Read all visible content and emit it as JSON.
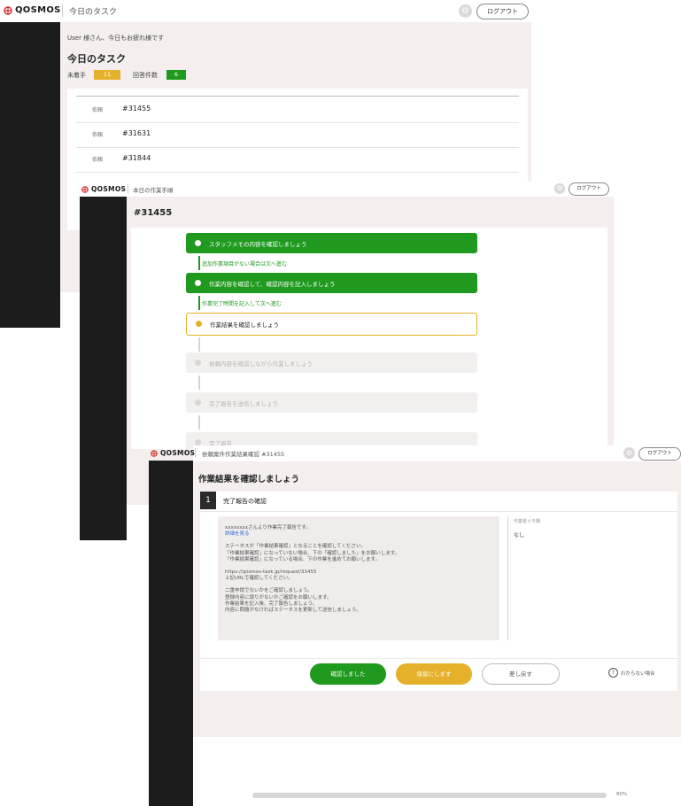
{
  "brand": {
    "logo": "QOSMOS"
  },
  "common": {
    "logout_label": "ログアウト",
    "gear_glyph": "⚙"
  },
  "window1": {
    "header_title": "今日のタスク",
    "greeting": "User 様さん、今日もお疲れ様です",
    "page_title": "今日のタスク",
    "stat_labels": [
      "未着手",
      "回答件数"
    ],
    "stat_values": [
      "11",
      "6"
    ],
    "rows": [
      {
        "label": "依頼",
        "value": "#31455"
      },
      {
        "label": "依頼",
        "value": "#31631"
      },
      {
        "label": "依頼",
        "value": "#31844"
      }
    ]
  },
  "window2": {
    "header_title": "本日の作業手順",
    "page_title": "#31455",
    "steps": [
      {
        "label": "スタッフメモの内容を確認しましょう",
        "state": "done"
      },
      {
        "label": "作業内容を確認して、確認内容を記入しましょう",
        "state": "done"
      },
      {
        "label": "作業結果を確認しましょう",
        "state": "current"
      },
      {
        "label": "依頼内容を確認しながら作業しましょう",
        "state": "todo"
      },
      {
        "label": "完了報告を送信しましょう",
        "state": "todo"
      },
      {
        "label": "完了報告",
        "state": "todo"
      }
    ],
    "notes": [
      "追加作業項目がない場合は次へ進む",
      "作業完了時間を記入して次へ進む"
    ]
  },
  "window3": {
    "header_title": "依頼案件作業結果確認 #31455",
    "page_title": "作業結果を確認しましょう",
    "section_number": "1",
    "section_title": "完了報告の確認",
    "message_lines": [
      "xxxxxxxxさんより作業完了報告です。",
      "詳細を見る",
      "",
      "ステータスが「作業結果確認」となることを確認してください。",
      "「作業結果確認」になっていない場合、下の「確認しました」をお願いします。",
      "「作業結果確認」になっている場合、下の作業を進めてお願いします。",
      "",
      "https://qosmos-task.jp/request/31455",
      "上記URLで確認してください。",
      "",
      "二重申請でないかをご確認しましょう。",
      "登録内容に誤りがないかご確認をお願いします。",
      "作業結果を記入後、完了報告しましょう。",
      "内容に問題がなければステータスを更新して送信しましょう。"
    ],
    "memo_label": "作業者メモ欄",
    "memo_value": "なし",
    "buttons": {
      "primary": "確認しました",
      "secondary": "保留にします",
      "tertiary": "差し戻す"
    },
    "help_label": "わからない場合",
    "zoom": "80%"
  },
  "colors": {
    "green": "#1f9a1f",
    "amber": "#e6b12a",
    "dark_bar": "#1c1c1c",
    "panel": "#f4efee"
  }
}
